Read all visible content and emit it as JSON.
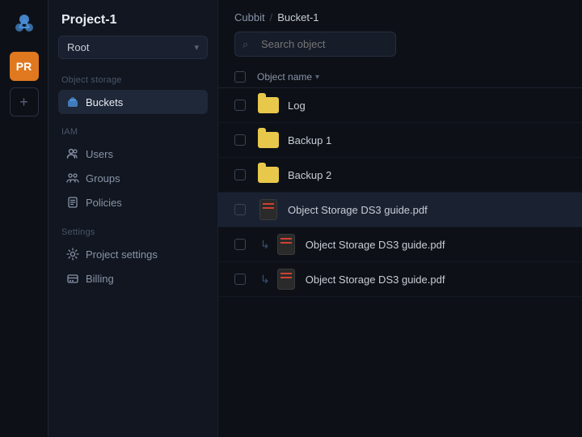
{
  "brand": {
    "icon_label": "cloud-icon"
  },
  "project_avatar": {
    "initials": "PR",
    "color": "#e07820"
  },
  "add_button_label": "+",
  "sidebar": {
    "project_title": "Project-1",
    "root_selector": "Root",
    "sections": [
      {
        "label": "Object storage",
        "items": [
          {
            "name": "Buckets",
            "icon": "bucket-icon",
            "active": true
          }
        ]
      },
      {
        "label": "IAM",
        "items": [
          {
            "name": "Users",
            "icon": "users-icon",
            "active": false
          },
          {
            "name": "Groups",
            "icon": "groups-icon",
            "active": false
          },
          {
            "name": "Policies",
            "icon": "policies-icon",
            "active": false
          }
        ]
      },
      {
        "label": "Settings",
        "items": [
          {
            "name": "Project settings",
            "icon": "settings-icon",
            "active": false
          },
          {
            "name": "Billing",
            "icon": "billing-icon",
            "active": false
          }
        ]
      }
    ]
  },
  "main": {
    "breadcrumb": {
      "parent": "Cubbit",
      "separator": "/",
      "current": "Bucket-1"
    },
    "search_placeholder": "Search object",
    "table": {
      "header_name": "Object name",
      "rows": [
        {
          "type": "folder",
          "name": "Log",
          "indent": false,
          "highlighted": false
        },
        {
          "type": "folder",
          "name": "Backup 1",
          "indent": false,
          "highlighted": false
        },
        {
          "type": "folder",
          "name": "Backup 2",
          "indent": false,
          "highlighted": false
        },
        {
          "type": "pdf",
          "name": "Object Storage DS3 guide.pdf",
          "indent": false,
          "highlighted": true
        },
        {
          "type": "pdf",
          "name": "Object Storage DS3 guide.pdf",
          "indent": true,
          "highlighted": false
        },
        {
          "type": "pdf",
          "name": "Object Storage DS3 guide.pdf",
          "indent": true,
          "highlighted": false
        }
      ]
    }
  }
}
